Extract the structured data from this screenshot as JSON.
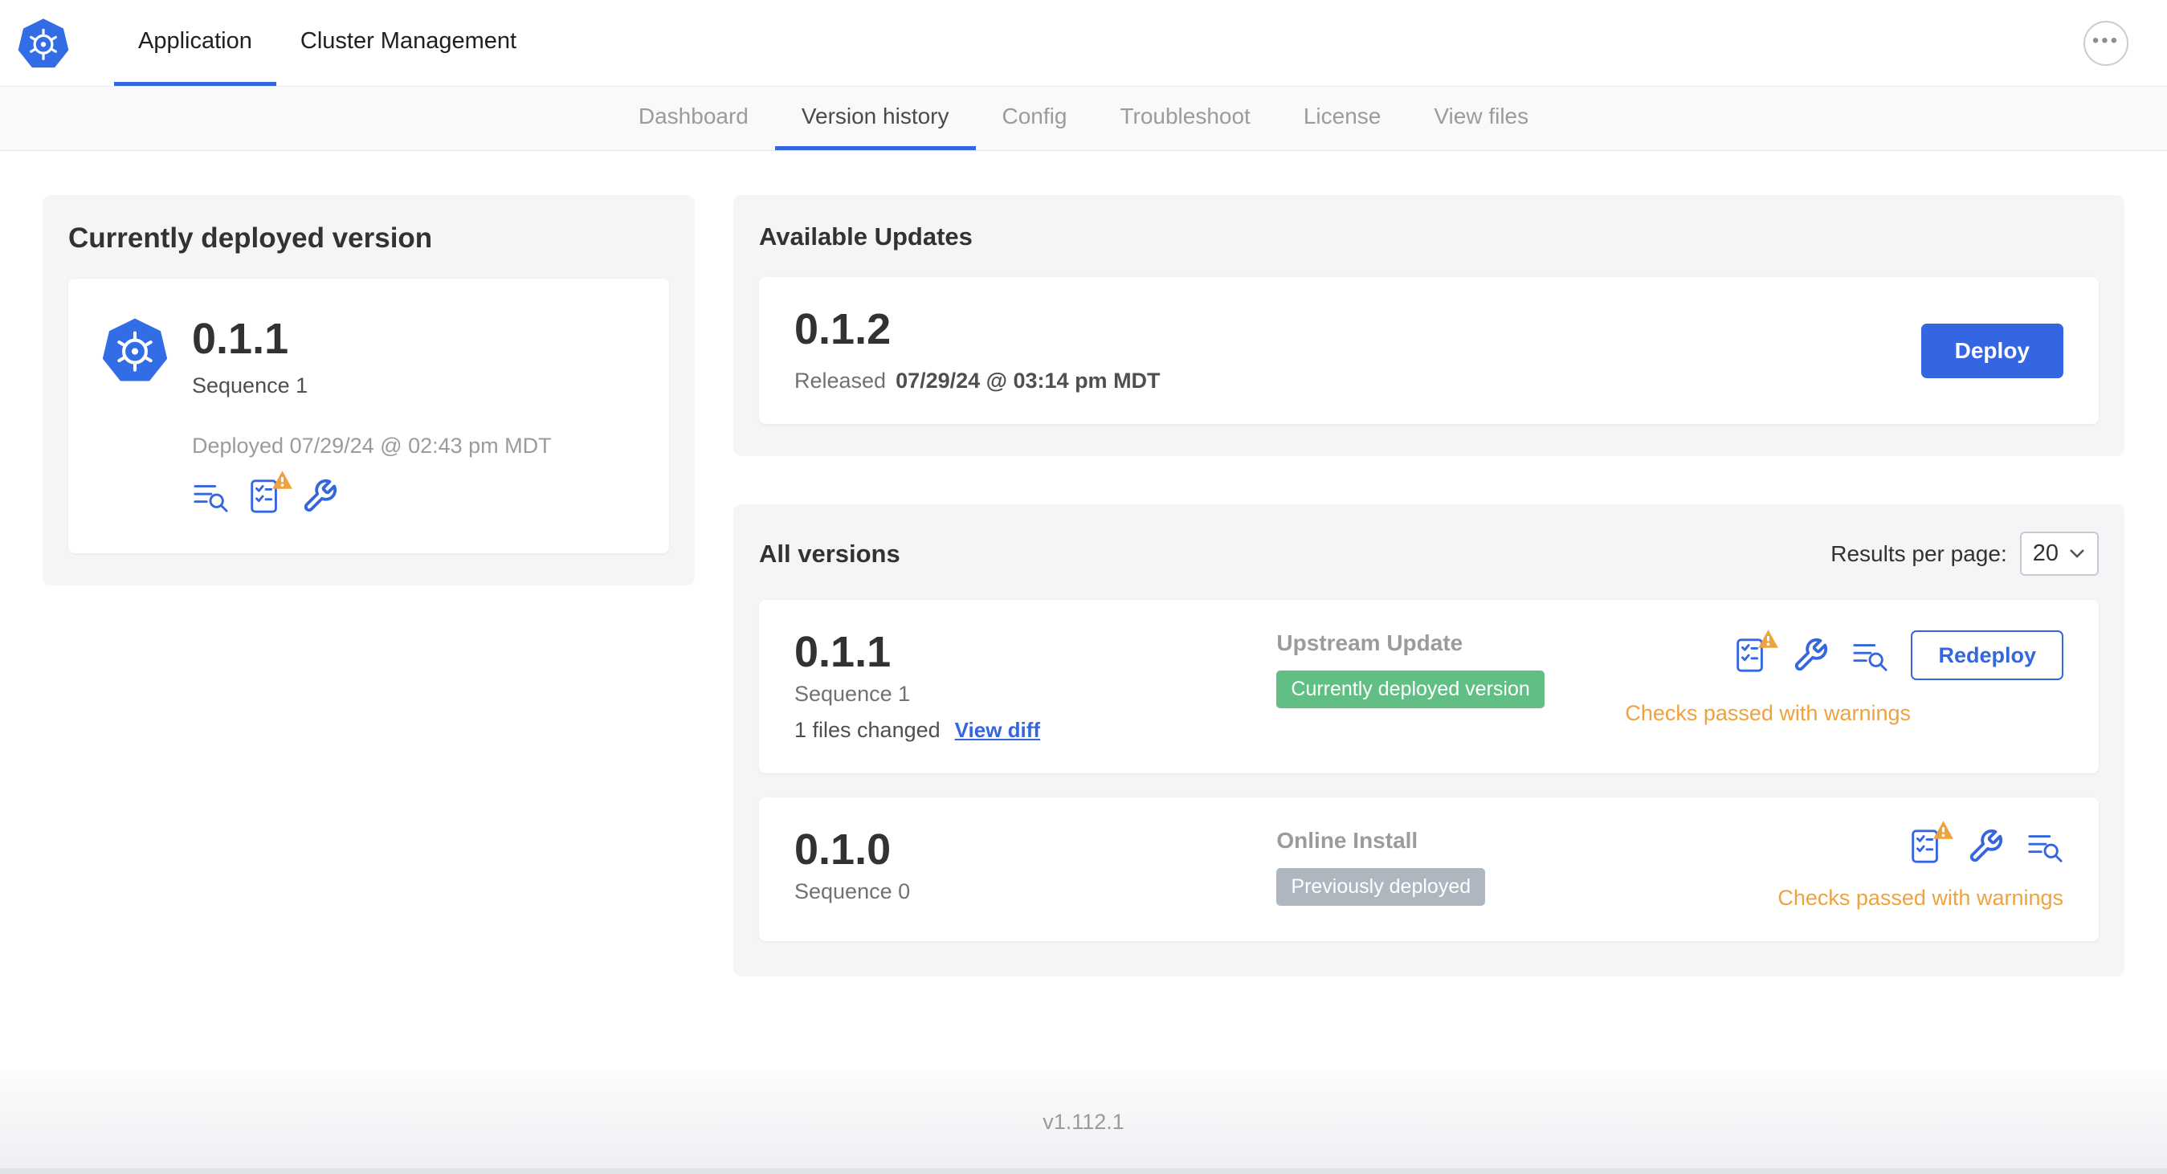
{
  "colors": {
    "accent": "#3366E0",
    "k8s_blue": "#326DE6",
    "success_green": "#61BF85",
    "badge_gray": "#AEB6C0",
    "warning_orange": "#EFA23D"
  },
  "topnav": {
    "tabs": [
      {
        "label": "Application",
        "active": true
      },
      {
        "label": "Cluster Management",
        "active": false
      }
    ]
  },
  "subnav": {
    "tabs": [
      {
        "label": "Dashboard",
        "active": false
      },
      {
        "label": "Version history",
        "active": true
      },
      {
        "label": "Config",
        "active": false
      },
      {
        "label": "Troubleshoot",
        "active": false
      },
      {
        "label": "License",
        "active": false
      },
      {
        "label": "View files",
        "active": false
      }
    ]
  },
  "current_version": {
    "title": "Currently deployed version",
    "version": "0.1.1",
    "sequence": "Sequence 1",
    "deployed": "Deployed 07/29/24 @ 02:43 pm MDT"
  },
  "available_updates": {
    "title": "Available Updates",
    "version": "0.1.2",
    "released_prefix": "Released",
    "released_date": "07/29/24 @ 03:14 pm MDT",
    "deploy_label": "Deploy"
  },
  "all_versions": {
    "title": "All versions",
    "results_per_page_label": "Results per page:",
    "results_per_page_value": "20",
    "rows": [
      {
        "version": "0.1.1",
        "sequence": "Sequence 1",
        "files_changed": "1 files changed",
        "view_diff_label": "View diff",
        "source": "Upstream Update",
        "badge": "Currently deployed version",
        "status": "Checks passed with warnings",
        "action_label": "Redeploy"
      },
      {
        "version": "0.1.0",
        "sequence": "Sequence 0",
        "source": "Online Install",
        "badge": "Previously deployed",
        "status": "Checks passed with warnings"
      }
    ]
  },
  "footer": {
    "version": "v1.112.1"
  }
}
